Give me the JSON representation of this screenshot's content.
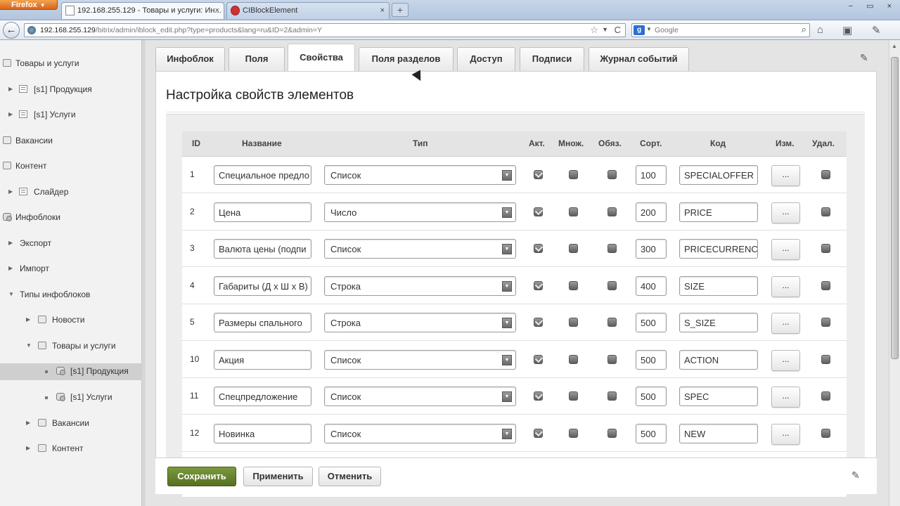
{
  "browser": {
    "menu_label": "Firefox",
    "tabs": [
      {
        "title": "192.168.255.129 - Товары и услуги: Ин...",
        "close": "×"
      },
      {
        "title": "CIBlockElement",
        "close": "×"
      }
    ],
    "new_tab": "+",
    "window_controls": "− ▭ ×",
    "back": "←",
    "url_host": "192.168.255.129",
    "url_path": "/bitrix/admin/iblock_edit.php?type=products&lang=ru&ID=2&admin=Y",
    "url_icons": {
      "star": "☆",
      "dropdown": "▼",
      "reload": "C"
    },
    "search_engine": "g",
    "search_dd": "▼",
    "search_placeholder": "Google",
    "search_icon": "⌕",
    "toolbar_icons": {
      "home": "⌂",
      "addons": "▣",
      "tools": "✎"
    }
  },
  "sidebar": {
    "items": [
      {
        "label": "Товары и услуги"
      },
      {
        "label": "[s1] Продукция"
      },
      {
        "label": "[s1] Услуги"
      },
      {
        "label": "Вакансии"
      },
      {
        "label": "Контент"
      },
      {
        "label": "Слайдер"
      },
      {
        "label": "Инфоблоки"
      },
      {
        "label": "Экспорт"
      },
      {
        "label": "Импорт"
      },
      {
        "label": "Типы инфоблоков"
      },
      {
        "label": "Новости"
      },
      {
        "label": "Товары и услуги"
      },
      {
        "label": "[s1] Продукция"
      },
      {
        "label": "[s1] Услуги"
      },
      {
        "label": "Вакансии"
      },
      {
        "label": "Контент"
      }
    ],
    "arrow_right": "▶",
    "arrow_down": "▼"
  },
  "tabs": [
    "Инфоблок",
    "Поля",
    "Свойства",
    "Поля разделов",
    "Доступ",
    "Подписи",
    "Журнал событий"
  ],
  "active_tab": "Свойства",
  "pin_icon": "✎",
  "panel_title": "Настройка свойств элементов",
  "columns": [
    "ID",
    "Название",
    "Тип",
    "Акт.",
    "Множ.",
    "Обяз.",
    "Сорт.",
    "Код",
    "Изм.",
    "Удал."
  ],
  "rows": [
    {
      "id": "1",
      "name": "Специальное предло",
      "type": "Список",
      "active": true,
      "multiple": false,
      "required": false,
      "sort": "100",
      "code": "SPECIALOFFER",
      "edit": "...",
      "delete": false
    },
    {
      "id": "2",
      "name": "Цена",
      "type": "Число",
      "active": true,
      "multiple": false,
      "required": false,
      "sort": "200",
      "code": "PRICE",
      "edit": "...",
      "delete": false
    },
    {
      "id": "3",
      "name": "Валюта цены (подпи",
      "type": "Список",
      "active": true,
      "multiple": false,
      "required": false,
      "sort": "300",
      "code": "PRICECURRENC",
      "edit": "...",
      "delete": false
    },
    {
      "id": "4",
      "name": "Габариты (Д x Ш x В)",
      "type": "Строка",
      "active": true,
      "multiple": false,
      "required": false,
      "sort": "400",
      "code": "SIZE",
      "edit": "...",
      "delete": false
    },
    {
      "id": "5",
      "name": "Размеры спального",
      "type": "Строка",
      "active": true,
      "multiple": false,
      "required": false,
      "sort": "500",
      "code": "S_SIZE",
      "edit": "...",
      "delete": false
    },
    {
      "id": "10",
      "name": "Акция",
      "type": "Список",
      "active": true,
      "multiple": false,
      "required": false,
      "sort": "500",
      "code": "ACTION",
      "edit": "...",
      "delete": false
    },
    {
      "id": "11",
      "name": "Спецпредложение",
      "type": "Список",
      "active": true,
      "multiple": false,
      "required": false,
      "sort": "500",
      "code": "SPEC",
      "edit": "...",
      "delete": false
    },
    {
      "id": "12",
      "name": "Новинка",
      "type": "Список",
      "active": true,
      "multiple": false,
      "required": false,
      "sort": "500",
      "code": "NEW",
      "edit": "...",
      "delete": false
    }
  ],
  "buttons": {
    "save": "Сохранить",
    "apply": "Применить",
    "cancel": "Отменить"
  },
  "colors": {
    "save_button": "#566f22",
    "sidebar_bg": "#f2f2f2",
    "active_tab_bg": "#ffffff"
  }
}
